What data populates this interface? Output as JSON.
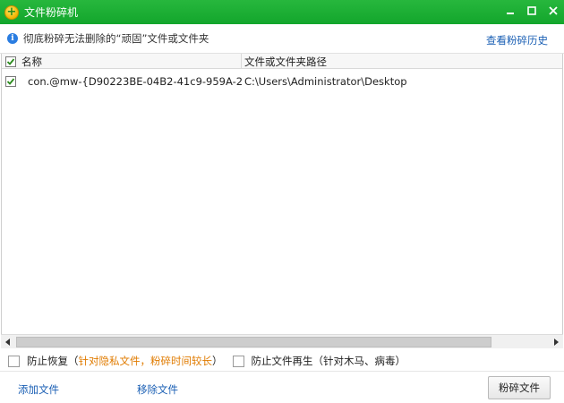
{
  "window": {
    "title": "文件粉碎机",
    "app_icon": "plus-badge-icon",
    "controls": [
      "minimize-icon",
      "maximize-icon",
      "close-icon"
    ],
    "accent_color": "#1aae32"
  },
  "info": {
    "icon": "info-icon",
    "text": "彻底粉碎无法删除的“顽固”文件或文件夹",
    "history_link": "查看粉碎历史"
  },
  "list": {
    "columns": [
      "名称",
      "文件或文件夹路径"
    ],
    "header_checked": true,
    "rows": [
      {
        "checked": true,
        "icon": "file-icon",
        "name": "con.@mw-{D90223BE-04B2-41c9-959A-2...",
        "path": "C:\\Users\\Administrator\\Desktop"
      }
    ]
  },
  "options": {
    "prevent_recovery": {
      "checked": false,
      "label": "防止恢复",
      "note_open": "（",
      "note": "针对隐私文件，粉碎时间较长",
      "note_close": "）",
      "note_color": "#e07b00"
    },
    "prevent_regen": {
      "checked": false,
      "label": "防止文件再生",
      "note": "（针对木马、病毒）"
    }
  },
  "footer": {
    "add_label": "添加文件",
    "remove_label": "移除文件",
    "shred_label": "粉碎文件"
  }
}
